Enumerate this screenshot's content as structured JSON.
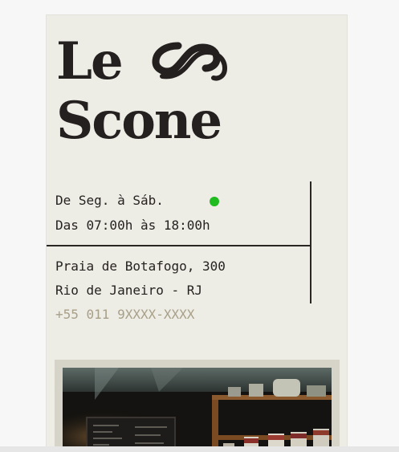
{
  "brand": {
    "name_line1": "Le",
    "name_line2": "Scone",
    "logo_mark_icon": "swirl-s-icon"
  },
  "hours": {
    "days": "De Seg. à Sáb.",
    "time": "Das 07:00h às 18:00h",
    "status_color": "#1fbb1f"
  },
  "address": {
    "line1": "Praia de Botafogo, 300",
    "line2": "Rio de Janeiro - RJ"
  },
  "contact": {
    "phone": "+55 011 9XXXX-XXXX"
  },
  "colors": {
    "panel_bg": "#edece5",
    "text": "#262220",
    "phone": "#a89f88"
  },
  "images": {
    "cafe_photo": "cafe-interior-photo"
  }
}
